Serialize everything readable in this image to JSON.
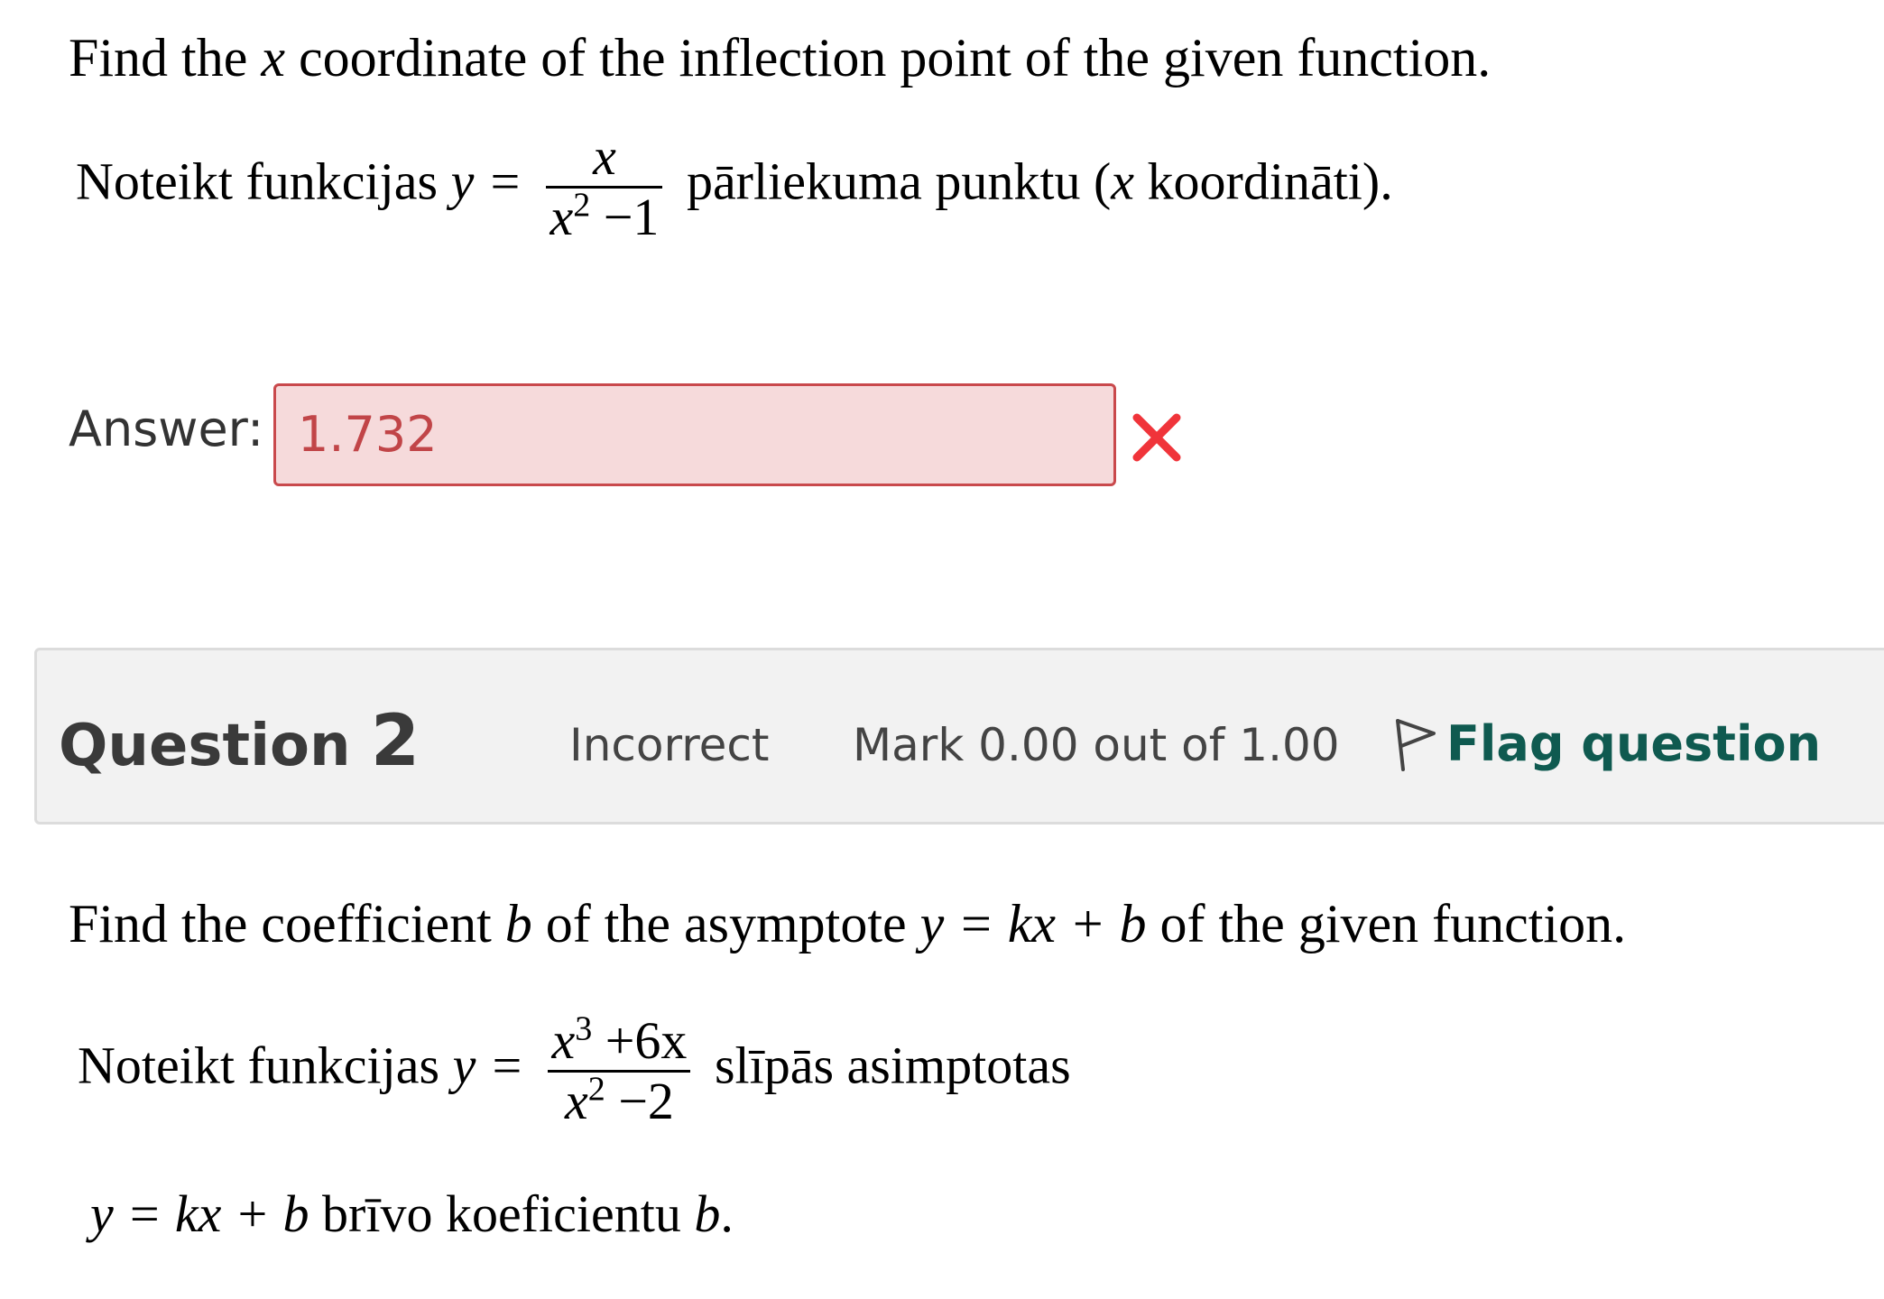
{
  "question1": {
    "prompt_before": "Find the ",
    "prompt_var": "x",
    "prompt_after": " coordinate of the inflection point of the given function.",
    "latvian_before": "Noteikt funkcijas ",
    "formula_lhs": "y =",
    "numerator": "x",
    "denominator_base": "x",
    "denominator_exp": "2",
    "denominator_rest": " −1",
    "latvian_after_1": " pārliekuma punktu (",
    "latvian_var": "x",
    "latvian_after_2": " koordināti).",
    "answer_label": "Answer:",
    "answer_value": "1.732",
    "answer_status": "incorrect"
  },
  "question2": {
    "title_word": "Question ",
    "number": "2",
    "state": "Incorrect",
    "grade": "Mark 0.00 out of 1.00",
    "flag_label": "Flag question",
    "prompt_before": "Find the coefficient ",
    "prompt_b": "b",
    "prompt_middle": " of the asymptote ",
    "prompt_formula": "y = kx + b",
    "prompt_after": " of the given function.",
    "latvian_before": "Noteikt funkcijas ",
    "formula_lhs": "y =",
    "numerator_base": "x",
    "numerator_exp": "3",
    "numerator_rest": " +6x",
    "denominator_base": "x",
    "denominator_exp": "2",
    "denominator_rest": " −2",
    "latvian_after": " slīpās asimptotas",
    "line2_formula": "y = kx + b",
    "line2_text": " brīvo koeficientu ",
    "line2_var": "b",
    "line2_end": "."
  },
  "colors": {
    "incorrect_bg": "#f6dadb",
    "incorrect_border": "#c9494c",
    "incorrect_text": "#c14548",
    "incorrect_icon": "#f0343a",
    "flag_link": "#0f5a50"
  },
  "icons": {
    "incorrect": "cross-icon",
    "flag": "flag-outline-icon"
  }
}
